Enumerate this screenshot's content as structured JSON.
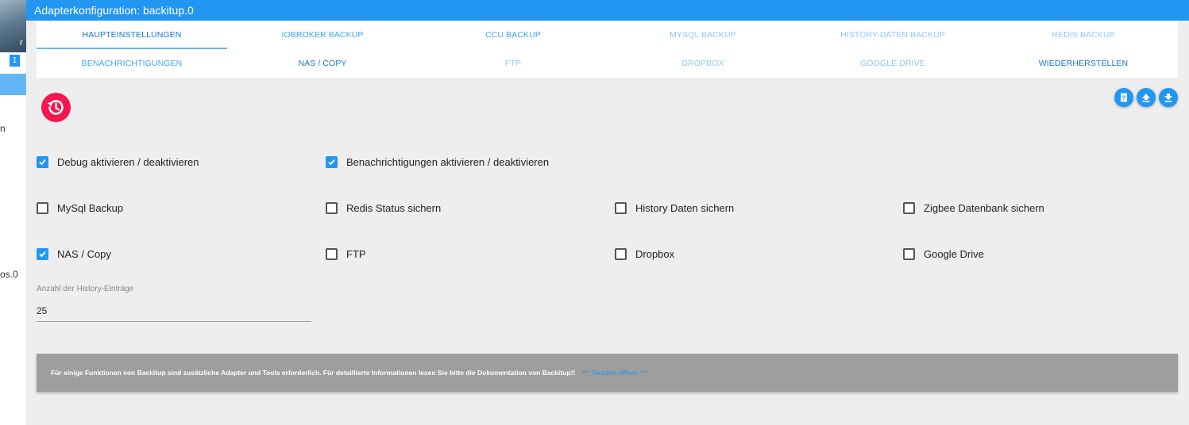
{
  "left_panel": {
    "avatar_label": "r",
    "badge": "1",
    "items": [
      "n",
      "os.0"
    ]
  },
  "header": {
    "title": "Adapterkonfiguration: backitup.0"
  },
  "tabs": [
    {
      "label": "Haupteinstellungen",
      "active": true
    },
    {
      "label": "ioBroker Backup"
    },
    {
      "label": "CCU Backup"
    },
    {
      "label": "MySql Backup"
    },
    {
      "label": "History-Daten Backup"
    },
    {
      "label": "Redis Backup"
    },
    {
      "label": "Benachrichtigungen"
    },
    {
      "label": "NAS / Copy"
    },
    {
      "label": "FTP"
    },
    {
      "label": "Dropbox"
    },
    {
      "label": "Google Drive"
    },
    {
      "label": "Wiederherstellen"
    }
  ],
  "actions": {
    "help_icon": "help-icon",
    "upload_icon": "upload-icon",
    "download_icon": "download-icon"
  },
  "options": [
    {
      "label": "Debug aktivieren / deaktivieren",
      "checked": true
    },
    {
      "label": "Benachrichtigungen aktivieren / deaktivieren",
      "checked": true
    },
    {
      "label": "MySql Backup",
      "checked": false
    },
    {
      "label": "Redis Status sichern",
      "checked": false
    },
    {
      "label": "History Daten sichern",
      "checked": false
    },
    {
      "label": "Zigbee Datenbank sichern",
      "checked": false
    },
    {
      "label": "NAS / Copy",
      "checked": true
    },
    {
      "label": "FTP",
      "checked": false
    },
    {
      "label": "Dropbox",
      "checked": false
    },
    {
      "label": "Google Drive",
      "checked": false
    }
  ],
  "history": {
    "label": "Anzahl der History-Einträge",
    "value": "25"
  },
  "info": {
    "text": "Für einige Funktionen von Backitup sind zusätzliche Adapter und Tools erforderlich. Für detaillierte Informationen lesen Sie bitte die Dokumentation von Backitup!!",
    "link": "*** Readme öffnen ***"
  },
  "colors": {
    "accent": "#2196f3",
    "logo": "#f5174d",
    "panel": "#9e9e9e",
    "background": "#eeeeee"
  }
}
